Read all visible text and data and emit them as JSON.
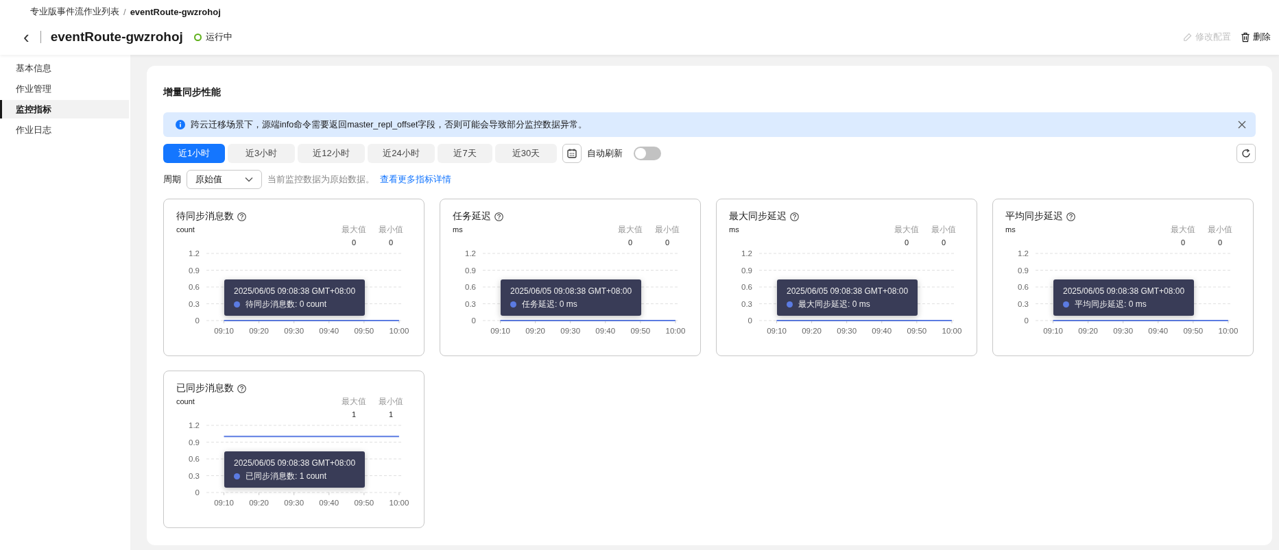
{
  "breadcrumb": [
    {
      "label": "专业版事件流作业列表",
      "current": false
    },
    {
      "label": "/",
      "kind": "sep"
    },
    {
      "label": "eventRoute-gwzrohoj",
      "current": true
    }
  ],
  "header": {
    "back": "‹",
    "title": "eventRoute-gwzrohoj",
    "status": {
      "label": "运行中",
      "color": "#5fb01b"
    },
    "actions": [
      {
        "label": "修改配置",
        "kind": "edit",
        "disabled": true
      },
      {
        "label": "删除",
        "kind": "delete",
        "disabled": false
      }
    ]
  },
  "sidebar": {
    "items": [
      {
        "label": "基本信息",
        "selected": false
      },
      {
        "label": "作业管理",
        "selected": false
      },
      {
        "label": "监控指标",
        "selected": true
      },
      {
        "label": "作业日志",
        "selected": false
      }
    ]
  },
  "panel": {
    "title": "增量同步性能",
    "alert": {
      "text": "跨云迁移场景下，源端info命令需要返回master_repl_offset字段，否则可能会导致部分监控数据异常。"
    },
    "ranges": [
      {
        "label": "近1小时",
        "selected": true
      },
      {
        "label": "近3小时",
        "selected": false
      },
      {
        "label": "近12小时",
        "selected": false
      },
      {
        "label": "近24小时",
        "selected": false
      },
      {
        "label": "近7天",
        "selected": false
      },
      {
        "label": "近30天",
        "selected": false
      }
    ],
    "auto_refresh": {
      "label": "自动刷新",
      "on": false
    },
    "period": {
      "label": "周期",
      "value": "原始值",
      "hint": "当前监控数据为原始数据。",
      "link": "查看更多指标详情"
    },
    "charts": [
      {
        "title": "待同步消息数",
        "unit": "count",
        "max_label": "最大值",
        "max": "0",
        "min_label": "最小值",
        "min": "0",
        "tooltip": {
          "time": "2025/06/05 09:08:38 GMT+08:00",
          "text": "待同步消息数: 0 count"
        },
        "chart_data": {
          "type": "line",
          "categories": [
            "09:10",
            "09:20",
            "09:30",
            "09:40",
            "09:50",
            "10:00"
          ],
          "ylim": [
            0,
            1.2
          ],
          "yticks": [
            0,
            0.3,
            0.6,
            0.9,
            1.2
          ],
          "grid": true,
          "series": [
            {
              "color": "#5b7be2",
              "values": [
                0,
                0,
                0,
                0,
                0,
                0
              ]
            }
          ]
        }
      },
      {
        "title": "任务延迟",
        "unit": "ms",
        "max_label": "最大值",
        "max": "0",
        "min_label": "最小值",
        "min": "0",
        "tooltip": {
          "time": "2025/06/05 09:08:38 GMT+08:00",
          "text": "任务延迟: 0 ms"
        },
        "chart_data": {
          "type": "line",
          "categories": [
            "09:10",
            "09:20",
            "09:30",
            "09:40",
            "09:50",
            "10:00"
          ],
          "ylim": [
            0,
            1.2
          ],
          "yticks": [
            0,
            0.3,
            0.6,
            0.9,
            1.2
          ],
          "grid": true,
          "series": [
            {
              "color": "#5b7be2",
              "values": [
                0,
                0,
                0,
                0,
                0,
                0
              ]
            }
          ]
        }
      },
      {
        "title": "最大同步延迟",
        "unit": "ms",
        "max_label": "最大值",
        "max": "0",
        "min_label": "最小值",
        "min": "0",
        "tooltip": {
          "time": "2025/06/05 09:08:38 GMT+08:00",
          "text": "最大同步延迟: 0 ms"
        },
        "chart_data": {
          "type": "line",
          "categories": [
            "09:10",
            "09:20",
            "09:30",
            "09:40",
            "09:50",
            "10:00"
          ],
          "ylim": [
            0,
            1.2
          ],
          "yticks": [
            0,
            0.3,
            0.6,
            0.9,
            1.2
          ],
          "grid": true,
          "series": [
            {
              "color": "#5b7be2",
              "values": [
                0,
                0,
                0,
                0,
                0,
                0
              ]
            }
          ]
        }
      },
      {
        "title": "平均同步延迟",
        "unit": "ms",
        "max_label": "最大值",
        "max": "0",
        "min_label": "最小值",
        "min": "0",
        "tooltip": {
          "time": "2025/06/05 09:08:38 GMT+08:00",
          "text": "平均同步延迟: 0 ms"
        },
        "chart_data": {
          "type": "line",
          "categories": [
            "09:10",
            "09:20",
            "09:30",
            "09:40",
            "09:50",
            "10:00"
          ],
          "ylim": [
            0,
            1.2
          ],
          "yticks": [
            0,
            0.3,
            0.6,
            0.9,
            1.2
          ],
          "grid": true,
          "series": [
            {
              "color": "#5b7be2",
              "values": [
                0,
                0,
                0,
                0,
                0,
                0
              ]
            }
          ]
        }
      },
      {
        "title": "已同步消息数",
        "unit": "count",
        "max_label": "最大值",
        "max": "1",
        "min_label": "最小值",
        "min": "1",
        "tooltip": {
          "time": "2025/06/05 09:08:38 GMT+08:00",
          "text": "已同步消息数: 1 count"
        },
        "chart_data": {
          "type": "line",
          "categories": [
            "09:10",
            "09:20",
            "09:30",
            "09:40",
            "09:50",
            "10:00"
          ],
          "ylim": [
            0,
            1.2
          ],
          "yticks": [
            0,
            0.3,
            0.6,
            0.9,
            1.2
          ],
          "grid": true,
          "series": [
            {
              "color": "#5b7be2",
              "values": [
                1,
                1,
                1,
                1,
                1,
                1
              ]
            }
          ]
        }
      }
    ]
  }
}
